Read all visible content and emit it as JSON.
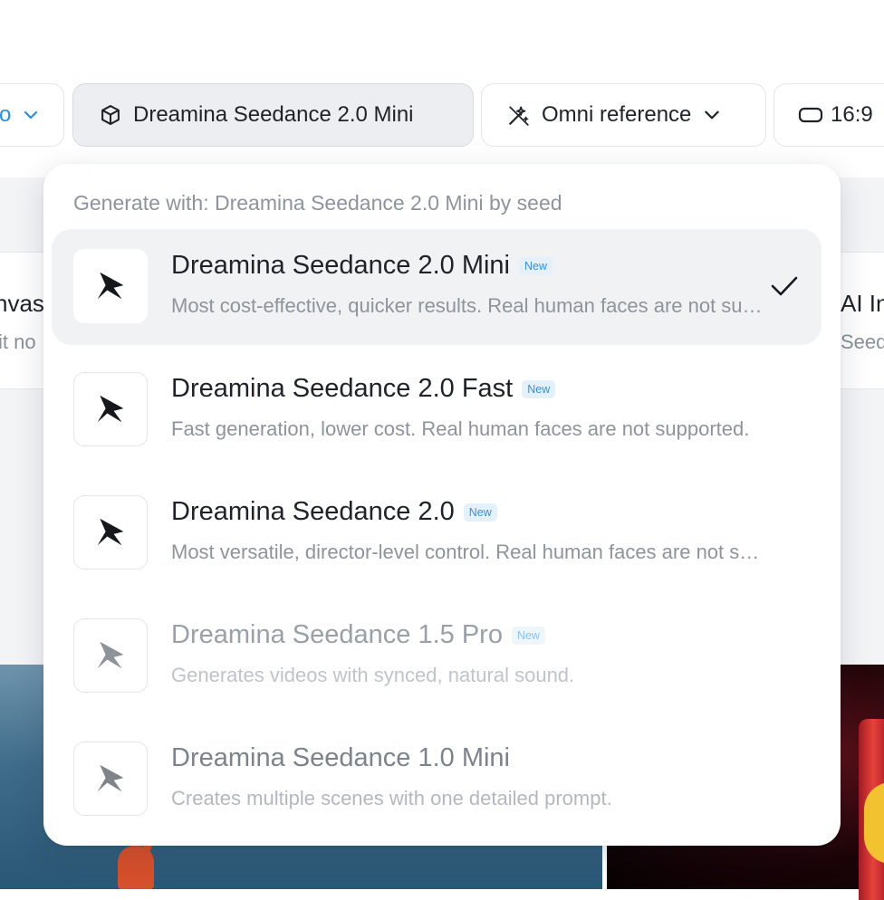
{
  "toolbar": {
    "left_chip_text": "o",
    "model_chip_label": "Dreamina Seedance 2.0 Mini",
    "reference_chip_label": "Omni reference",
    "ratio_chip_label": "16:9"
  },
  "background": {
    "left_card_title": "nvas",
    "left_card_sub": "it no",
    "right_card_title": "AI In",
    "right_card_sub": "Seed"
  },
  "dropdown": {
    "header": "Generate with: Dreamina Seedance 2.0 Mini by seed",
    "items": [
      {
        "title": "Dreamina Seedance 2.0 Mini",
        "badge": "New",
        "description": "Most cost-effective, quicker results. Real human faces are not supported.",
        "selected": true
      },
      {
        "title": "Dreamina Seedance 2.0 Fast",
        "badge": "New",
        "description": "Fast generation, lower cost. Real human faces are not supported.",
        "selected": false
      },
      {
        "title": "Dreamina Seedance 2.0",
        "badge": "New",
        "description": "Most versatile, director-level control. Real human faces are not supported.",
        "selected": false
      },
      {
        "title": "Dreamina Seedance 1.5 Pro",
        "badge": "New",
        "description": "Generates videos with synced, natural sound.",
        "selected": false
      },
      {
        "title": "Dreamina Seedance 1.0 Mini",
        "badge": "",
        "description": "Creates multiple scenes with one detailed prompt.",
        "selected": false
      }
    ]
  },
  "colors": {
    "accent": "#2f8fd6",
    "badge_bg": "#e4f1fb",
    "selected_row_bg": "#f1f2f4"
  },
  "icons": {
    "model_chip": "cube-icon",
    "reference_chip": "magic-wand-icon",
    "ratio_chip": "rounded-rectangle-icon",
    "model_logo": "seedance-logo-icon",
    "selected_mark": "check-icon",
    "dropdown_chevron": "chevron-down-icon"
  }
}
